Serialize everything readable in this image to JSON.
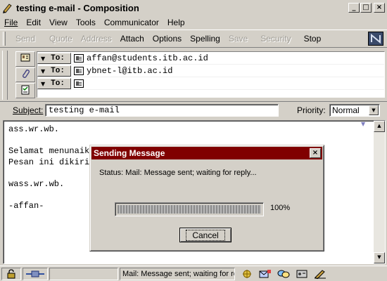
{
  "window": {
    "title": "testing e-mail - Composition",
    "minimize_label": "_",
    "maximize_label": "□",
    "close_label": "×"
  },
  "menu": [
    "File",
    "Edit",
    "View",
    "Tools",
    "Communicator",
    "Help"
  ],
  "toolbar": {
    "send": "Send",
    "quote": "Quote",
    "address": "Address",
    "attach": "Attach",
    "options": "Options",
    "spelling": "Spelling",
    "save": "Save",
    "security": "Security",
    "stop": "Stop"
  },
  "recipients": [
    {
      "type": "To:",
      "value": "affan@students.itb.ac.id"
    },
    {
      "type": "To:",
      "value": "ybnet-l@itb.ac.id"
    },
    {
      "type": "To:",
      "value": ""
    }
  ],
  "subject": {
    "label": "Subject:",
    "value": "testing e-mail"
  },
  "priority": {
    "label": "Priority:",
    "value": "Normal"
  },
  "body": {
    "text": "ass.wr.wb.\n\nSelamat menunaike\nPesan ini dikirin\n\nwass.wr.wb.\n\n-affan-"
  },
  "dialog": {
    "title": "Sending Message",
    "close_label": "×",
    "status": "Status:  Mail: Message sent; waiting for reply...",
    "progress_percent_text": "100%",
    "progress_fraction": 1.0,
    "cancel_label": "Cancel"
  },
  "statusbar": {
    "message": "Mail: Message sent; waiting for rep"
  },
  "colors": {
    "dialog_title_bg": "#800000",
    "chrome": "#d4d0c8"
  }
}
